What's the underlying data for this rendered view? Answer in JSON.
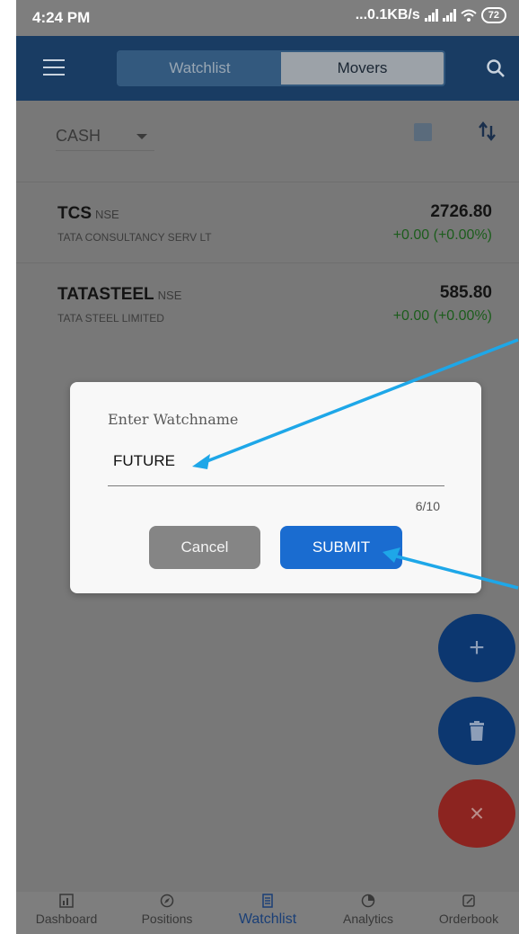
{
  "status_bar": {
    "time": "4:24 PM",
    "network_speed": "...0.1KB/s",
    "battery": "72"
  },
  "app_bar": {
    "tabs": [
      {
        "label": "Watchlist",
        "active": true
      },
      {
        "label": "Movers",
        "active": false
      }
    ],
    "icons": [
      "menu-icon",
      "search-icon"
    ]
  },
  "filter": {
    "segment": "CASH"
  },
  "watchlist": [
    {
      "symbol": "TCS",
      "exchange": "NSE",
      "name": "TATA CONSULTANCY SERV LT",
      "ltp": "2726.80",
      "change": "+0.00 (+0.00%)"
    },
    {
      "symbol": "TATASTEEL",
      "exchange": "NSE",
      "name": "TATA STEEL LIMITED",
      "ltp": "585.80",
      "change": "+0.00 (+0.00%)"
    }
  ],
  "dialog": {
    "label": "Enter Watchname",
    "value": "FUTURE",
    "counter": "6/10",
    "cancel_label": "Cancel",
    "submit_label": "SUBMIT"
  },
  "fabs": {
    "add": "+",
    "close": "×"
  },
  "bottom_nav": [
    {
      "label": "Dashboard",
      "icon": "dashboard-icon"
    },
    {
      "label": "Positions",
      "icon": "compass-icon"
    },
    {
      "label": "Watchlist",
      "icon": "list-icon",
      "active": true
    },
    {
      "label": "Analytics",
      "icon": "pie-chart-icon"
    },
    {
      "label": "Orderbook",
      "icon": "edit-book-icon"
    }
  ],
  "colors": {
    "app_bar": "#193c63",
    "submit": "#1a6cd0",
    "positive_change": "#1c5d1c",
    "annotation_arrow": "#1ea7e8",
    "fab_close": "#8c2420"
  }
}
